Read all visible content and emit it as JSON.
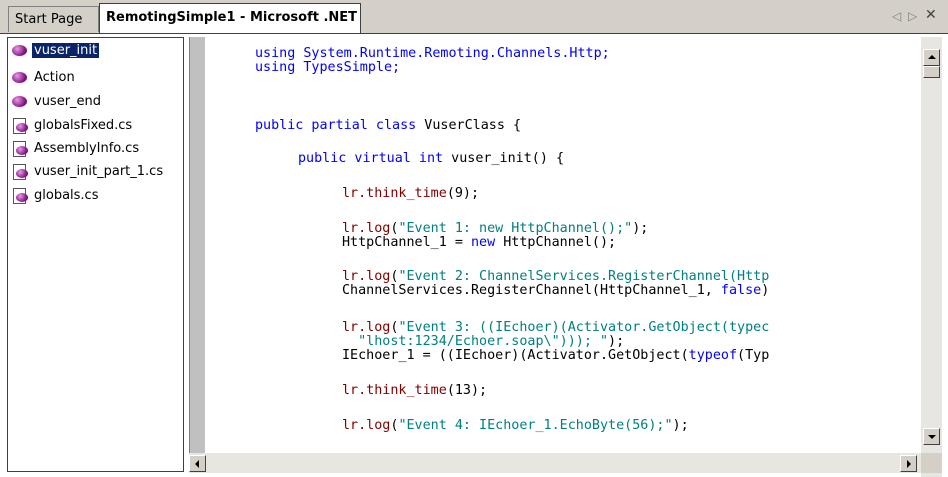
{
  "tabs": {
    "start_page": "Start Page",
    "active": "RemotingSimple1 - Microsoft .NET",
    "nav_left": "◁",
    "nav_right": "▷",
    "close": "✕"
  },
  "tree": {
    "items": [
      {
        "label": "vuser_init",
        "icon": "sphere-icon",
        "selected": true
      },
      {
        "label": "Action",
        "icon": "sphere-icon"
      },
      {
        "label": "vuser_end",
        "icon": "sphere-icon"
      },
      {
        "label": "globalsFixed.cs",
        "icon": "cs-file-icon"
      },
      {
        "label": "AssemblyInfo.cs",
        "icon": "cs-file-icon"
      },
      {
        "label": "vuser_init_part_1.cs",
        "icon": "cs-file-icon"
      },
      {
        "label": "globals.cs",
        "icon": "cs-file-icon"
      }
    ]
  },
  "code": {
    "l01": "using System.Runtime.Remoting.Channels.Http;",
    "l02": "using TypesSimple;",
    "l03_kw": "public partial class",
    "l03_rest": " VuserClass {",
    "l04_kw": "public virtual int",
    "l04_rest": " vuser_init() {",
    "l05_call": "lr.think_time",
    "l05_rest": "(9);",
    "l06_call": "lr.log",
    "l06_open": "(",
    "l06_str": "\"Event 1: new HttpChannel();\"",
    "l06_close": ");",
    "l07_a": "HttpChannel_1 = ",
    "l07_kw": "new",
    "l07_b": " HttpChannel();",
    "l08_call": "lr.log",
    "l08_open": "(",
    "l08_str": "\"Event 2: ChannelServices.RegisterChannel(Http",
    "l09_a": "ChannelServices.RegisterChannel(HttpChannel_1, ",
    "l09_kw": "false",
    "l09_b": ")",
    "l10_call": "lr.log",
    "l10_open": "(",
    "l10_str": "\"Event 3: ((IEchoer)(Activator.GetObject(typec",
    "l11_str": "  \"lhost:1234/Echoer.soap\\\"))); \"",
    "l11_close": ");",
    "l12_a": "IEchoer_1 = ((IEchoer)(Activator.GetObject(",
    "l12_kw": "typeof",
    "l12_b": "(Typ",
    "l13_call": "lr.think_time",
    "l13_rest": "(13);",
    "l14_call": "lr.log",
    "l14_open": "(",
    "l14_str": "\"Event 4: IEchoer_1.EchoByte(56);\"",
    "l14_close": ");"
  }
}
